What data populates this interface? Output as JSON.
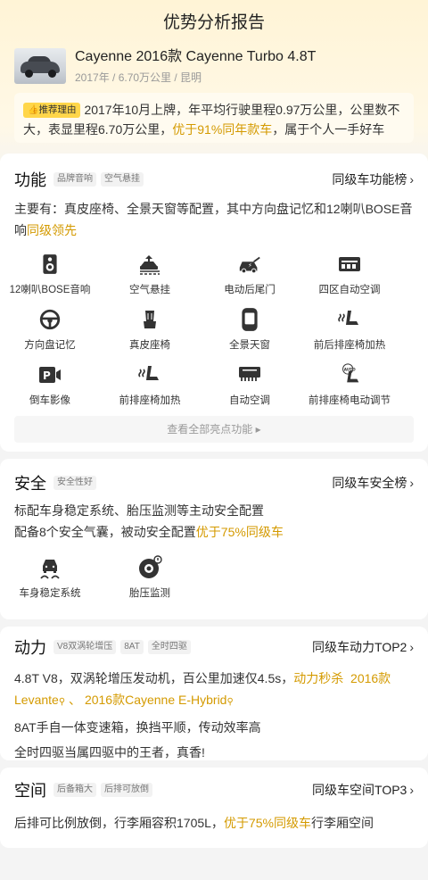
{
  "header": {
    "title": "优势分析报告"
  },
  "car": {
    "name": "Cayenne 2016款 Cayenne Turbo 4.8T",
    "meta": "2017年 / 6.70万公里 / 昆明"
  },
  "recommend": {
    "badge": "推荐理由",
    "text_a": "2017年10月上牌，年平均行驶里程0.97万公里，公里数不大，表显里程6.70万公里，",
    "highlight": "优于91%同年款车",
    "text_b": "，属于个人一手好车"
  },
  "features_section": {
    "title": "功能",
    "tags": [
      "品牌音响",
      "空气悬挂"
    ],
    "rank_link": "同级车功能榜",
    "desc": "主要有：真皮座椅、全景天窗等配置，其中方向盘记忆和12喇叭BOSE音响",
    "desc_highlight": "同级领先",
    "items": [
      {
        "label": "12喇叭BOSE音响",
        "icon": "speaker-icon"
      },
      {
        "label": "空气悬挂",
        "icon": "air-suspension-icon"
      },
      {
        "label": "电动后尾门",
        "icon": "power-tailgate-icon"
      },
      {
        "label": "四区自动空调",
        "icon": "climate-icon"
      },
      {
        "label": "方向盘记忆",
        "icon": "steering-wheel-icon"
      },
      {
        "label": "真皮座椅",
        "icon": "leather-seat-icon"
      },
      {
        "label": "全景天窗",
        "icon": "sunroof-icon"
      },
      {
        "label": "前后排座椅加热",
        "icon": "seat-heating-icon"
      },
      {
        "label": "倒车影像",
        "icon": "reverse-camera-icon"
      },
      {
        "label": "前排座椅加热",
        "icon": "seat-heating-icon"
      },
      {
        "label": "自动空调",
        "icon": "auto-ac-icon"
      },
      {
        "label": "前排座椅电动调节",
        "icon": "auto-seat-icon"
      }
    ],
    "view_all": "查看全部亮点功能"
  },
  "safety_section": {
    "title": "安全",
    "tags": [
      "安全性好"
    ],
    "rank_link": "同级车安全榜",
    "line1": "标配车身稳定系统、胎压监测等主动安全配置",
    "line2_a": "配备8个安全气囊，被动安全配置",
    "line2_highlight": "优于75%同级车",
    "items": [
      {
        "label": "车身稳定系统",
        "icon": "stability-icon"
      },
      {
        "label": "胎压监测",
        "icon": "tire-pressure-icon"
      }
    ]
  },
  "power_section": {
    "title": "动力",
    "tags": [
      "V8双涡轮增压",
      "8AT",
      "全时四驱"
    ],
    "rank_link": "同级车动力TOP2",
    "line1_a": "4.8T V8，双涡轮增压发动机，百公里加速仅4.5s，",
    "line1_highlight": "动力秒杀",
    "link1": "2016款 Levante",
    "sep": "、",
    "link2": "2016款Cayenne E-Hybrid",
    "line2": "8AT手自一体变速箱，换挡平顺，传动效率高",
    "line3": "全时四驱当属四驱中的王者，真香!"
  },
  "space_section": {
    "title": "空间",
    "tags": [
      "后备箱大",
      "后排可放倒"
    ],
    "rank_link": "同级车空间TOP3",
    "line1_a": "后排可比例放倒，行李厢容积1705L，",
    "line1_highlight": "优于75%同级车",
    "line1_b": "行李厢空间"
  },
  "colors": {
    "accent": "#d49a00",
    "badge": "#ffd64a"
  }
}
